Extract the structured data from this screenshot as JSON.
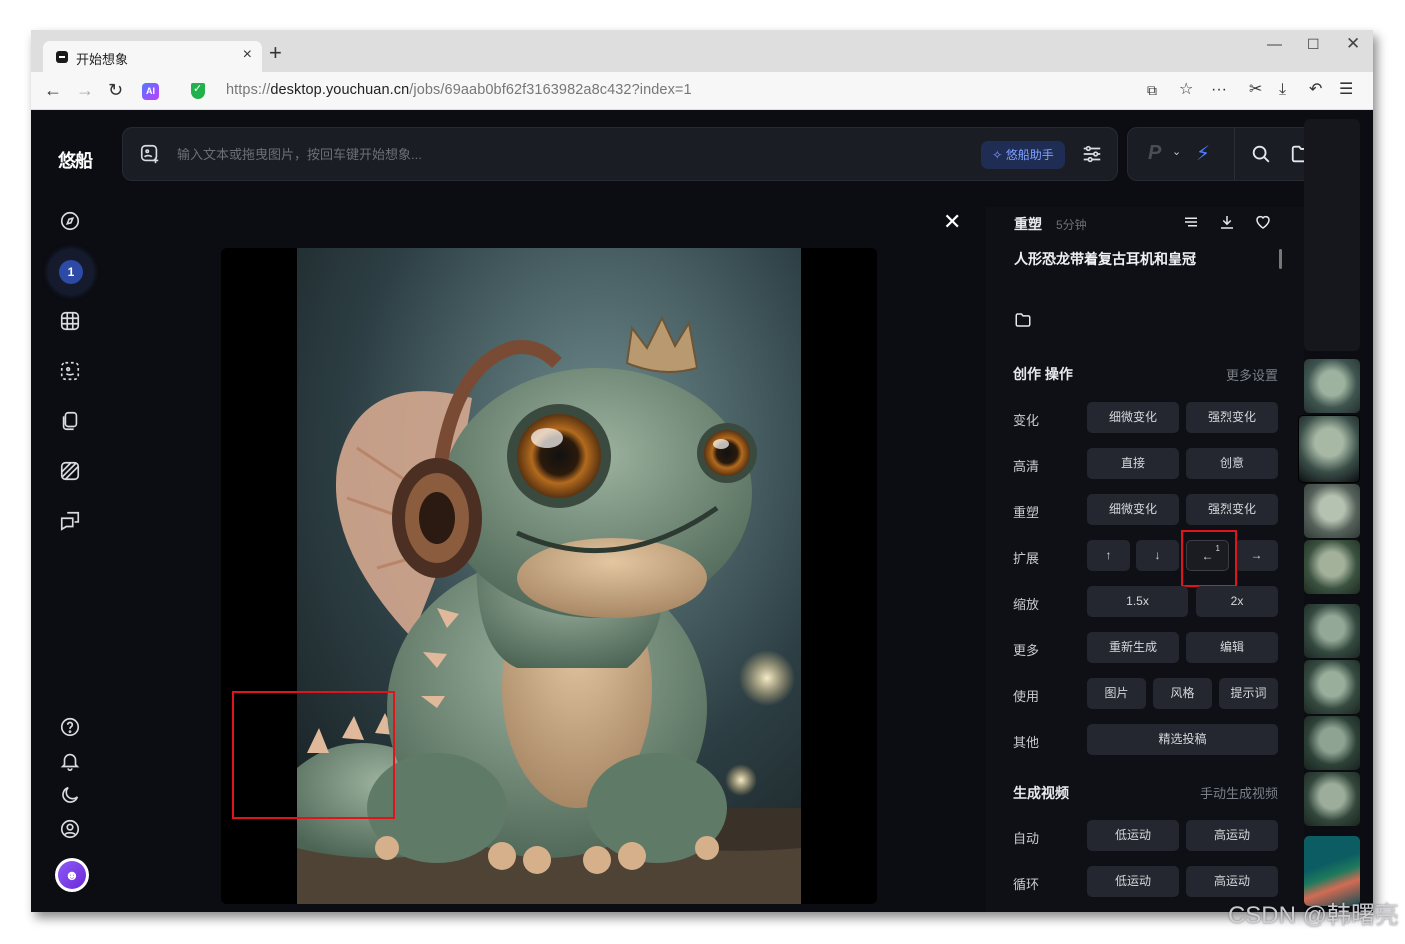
{
  "browser": {
    "tab_title": "开始想象",
    "url_prefix": "https://",
    "url_host": "desktop.youchuan.cn",
    "url_path": "/jobs/69aab0bf62f3163982a8c432?index=1",
    "ai_badge": "AI"
  },
  "sidebar": {
    "logo": "悠船",
    "badge_count": "1",
    "icons": [
      "compass-icon",
      "grid-icon",
      "select-icon",
      "copy-icon",
      "texture-icon",
      "chat-icon",
      "help-icon",
      "bell-icon",
      "moon-icon",
      "user-icon"
    ]
  },
  "prompt_bar": {
    "placeholder": "输入文本或拖曳图片，按回车键开始想象...",
    "assistant_label": "悠船助手",
    "mode_letter": "P"
  },
  "panel": {
    "title": "重塑",
    "time": "5分钟",
    "prompt": "人形恐龙带着复古耳机和皇冠",
    "creation_title": "创作 操作",
    "more_settings": "更多设置",
    "rows": [
      {
        "label": "变化",
        "buttons": [
          "细微变化",
          "强烈变化"
        ]
      },
      {
        "label": "高清",
        "buttons": [
          "直接",
          "创意"
        ]
      },
      {
        "label": "重塑",
        "buttons": [
          "细微变化",
          "强烈变化"
        ]
      },
      {
        "label": "扩展",
        "buttons": [
          "↑",
          "↓",
          "←",
          "→"
        ],
        "badge": "1"
      },
      {
        "label": "缩放",
        "buttons": [
          "1.5x",
          "2x"
        ]
      },
      {
        "label": "更多",
        "buttons": [
          "重新生成",
          "编辑"
        ]
      },
      {
        "label": "使用",
        "buttons": [
          "图片",
          "风格",
          "提示词"
        ]
      },
      {
        "label": "其他",
        "buttons": [
          "精选投稿"
        ]
      }
    ],
    "video_title": "生成视频",
    "video_link": "手动生成视频",
    "video_rows": [
      {
        "label": "自动",
        "buttons": [
          "低运动",
          "高运动"
        ]
      },
      {
        "label": "循环",
        "buttons": [
          "低运动",
          "高运动"
        ]
      }
    ]
  },
  "watermark": "CSDN @韩曙亮",
  "colors": {
    "accent": "#4e7dff",
    "highlight": "#e0141b",
    "background": "#0b0d12"
  }
}
